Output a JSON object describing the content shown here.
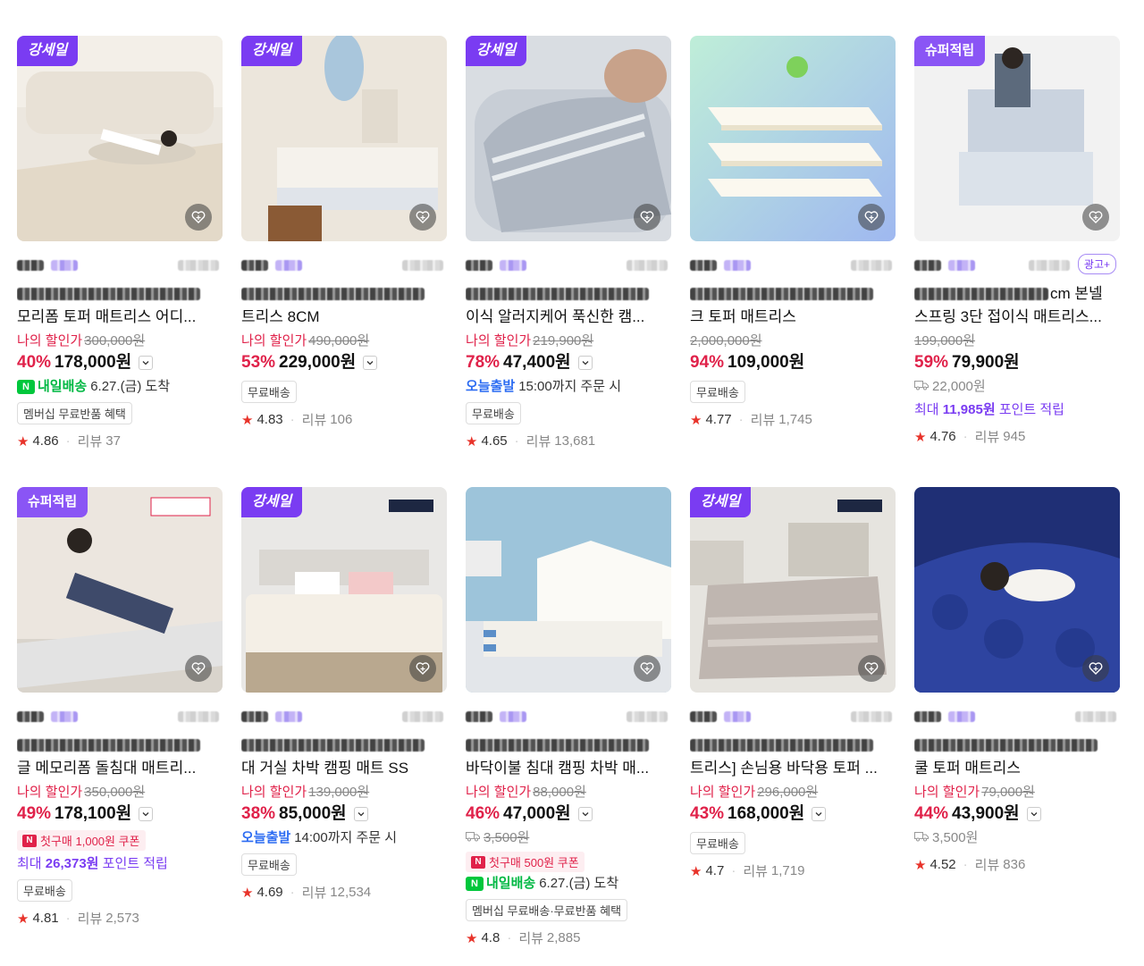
{
  "products": [
    {
      "badge": "강세일",
      "badge_type": "sale",
      "ad_label": "",
      "title_l2": "모리폼 토퍼 매트리스 어디...",
      "title_l1_tail": "",
      "my_price_label": "나의 할인가",
      "original_price": "300,000원",
      "rate": "40%",
      "price": "178,000원",
      "delivery_type": "nday",
      "delivery_text": "내일배송",
      "delivery_detail": "6.27.(금) 도착",
      "ship_fee": "",
      "chips": [
        "멤버십 무료반품 혜택"
      ],
      "coupon": "",
      "points_prefix": "",
      "points_amount": "",
      "points_suffix": "",
      "rating": "4.86",
      "review_label": "리뷰",
      "review_count": "37"
    },
    {
      "badge": "강세일",
      "badge_type": "sale",
      "ad_label": "",
      "title_l2": "트리스 8CM",
      "title_l1_tail": "",
      "my_price_label": "나의 할인가",
      "original_price": "490,000원",
      "rate": "53%",
      "price": "229,000원",
      "delivery_type": "",
      "delivery_text": "",
      "delivery_detail": "",
      "ship_fee": "",
      "chips": [
        "무료배송"
      ],
      "coupon": "",
      "points_prefix": "",
      "points_amount": "",
      "points_suffix": "",
      "rating": "4.83",
      "review_label": "리뷰",
      "review_count": "106"
    },
    {
      "badge": "강세일",
      "badge_type": "sale",
      "ad_label": "",
      "title_l2": "이식 알러지케어 푹신한 캠...",
      "title_l1_tail": "",
      "my_price_label": "나의 할인가",
      "original_price": "219,900원",
      "rate": "78%",
      "price": "47,400원",
      "delivery_type": "today",
      "delivery_text": "오늘출발",
      "delivery_detail": "15:00까지 주문 시",
      "ship_fee": "",
      "chips": [
        "무료배송"
      ],
      "coupon": "",
      "points_prefix": "",
      "points_amount": "",
      "points_suffix": "",
      "rating": "4.65",
      "review_label": "리뷰",
      "review_count": "13,681"
    },
    {
      "badge": "",
      "badge_type": "",
      "ad_label": "",
      "title_l2": "크 토퍼 매트리스",
      "title_l1_tail": "",
      "my_price_label": "",
      "original_price": "2,000,000원",
      "rate": "94%",
      "price": "109,000원",
      "delivery_type": "",
      "delivery_text": "",
      "delivery_detail": "",
      "ship_fee": "",
      "chips": [
        "무료배송"
      ],
      "coupon": "",
      "points_prefix": "",
      "points_amount": "",
      "points_suffix": "",
      "rating": "4.77",
      "review_label": "리뷰",
      "review_count": "1,745"
    },
    {
      "badge": "슈퍼적립",
      "badge_type": "super",
      "ad_label": "광고+",
      "title_l2": "스프링 3단 접이식 매트리스...",
      "title_l1_tail": "cm 본넬",
      "my_price_label": "",
      "original_price": "199,000원",
      "rate": "59%",
      "price": "79,900원",
      "delivery_type": "",
      "delivery_text": "",
      "delivery_detail": "",
      "ship_fee": "22,000원",
      "chips": [],
      "coupon": "",
      "points_prefix": "최대",
      "points_amount": "11,985원",
      "points_suffix": "포인트 적립",
      "rating": "4.76",
      "review_label": "리뷰",
      "review_count": "945"
    },
    {
      "badge": "슈퍼적립",
      "badge_type": "super",
      "ad_label": "",
      "title_l2": "글 메모리폼 돌침대 매트리...",
      "title_l1_tail": "",
      "my_price_label": "나의 할인가",
      "original_price": "350,000원",
      "rate": "49%",
      "price": "178,100원",
      "delivery_type": "",
      "delivery_text": "",
      "delivery_detail": "",
      "ship_fee": "",
      "chips": [
        "무료배송"
      ],
      "coupon": "첫구매 1,000원 쿠폰",
      "points_prefix": "최대",
      "points_amount": "26,373원",
      "points_suffix": "포인트 적립",
      "rating": "4.81",
      "review_label": "리뷰",
      "review_count": "2,573"
    },
    {
      "badge": "강세일",
      "badge_type": "sale",
      "ad_label": "",
      "title_l2": "대 거실 차박 캠핑 매트 SS",
      "title_l1_tail": "",
      "my_price_label": "나의 할인가",
      "original_price": "139,000원",
      "rate": "38%",
      "price": "85,000원",
      "delivery_type": "today",
      "delivery_text": "오늘출발",
      "delivery_detail": "14:00까지 주문 시",
      "ship_fee": "",
      "chips": [
        "무료배송"
      ],
      "coupon": "",
      "points_prefix": "",
      "points_amount": "",
      "points_suffix": "",
      "rating": "4.69",
      "review_label": "리뷰",
      "review_count": "12,534"
    },
    {
      "badge": "",
      "badge_type": "",
      "ad_label": "",
      "title_l2": "바닥이불 침대 캠핑 차박 매...",
      "title_l1_tail": "",
      "my_price_label": "나의 할인가",
      "original_price": "88,000원",
      "rate": "46%",
      "price": "47,000원",
      "delivery_type": "nday",
      "delivery_text": "내일배송",
      "delivery_detail": "6.27.(금) 도착",
      "ship_fee": "3,500원",
      "chips": [
        "멤버십 무료배송·무료반품 혜택"
      ],
      "coupon": "첫구매 500원 쿠폰",
      "points_prefix": "",
      "points_amount": "",
      "points_suffix": "",
      "rating": "4.8",
      "review_label": "리뷰",
      "review_count": "2,885"
    },
    {
      "badge": "강세일",
      "badge_type": "sale",
      "ad_label": "",
      "title_l2": "트리스] 손님용 바닥용 토퍼 ...",
      "title_l1_tail": "",
      "my_price_label": "나의 할인가",
      "original_price": "296,000원",
      "rate": "43%",
      "price": "168,000원",
      "delivery_type": "",
      "delivery_text": "",
      "delivery_detail": "",
      "ship_fee": "",
      "chips": [
        "무료배송"
      ],
      "coupon": "",
      "points_prefix": "",
      "points_amount": "",
      "points_suffix": "",
      "rating": "4.7",
      "review_label": "리뷰",
      "review_count": "1,719"
    },
    {
      "badge": "",
      "badge_type": "",
      "ad_label": "",
      "title_l2": "쿨 토퍼 매트리스",
      "title_l1_tail": "",
      "my_price_label": "나의 할인가",
      "original_price": "79,000원",
      "rate": "44%",
      "price": "43,900원",
      "delivery_type": "",
      "delivery_text": "",
      "delivery_detail": "",
      "ship_fee": "3,500원",
      "chips": [],
      "coupon": "",
      "points_prefix": "",
      "points_amount": "",
      "points_suffix": "",
      "rating": "4.52",
      "review_label": "리뷰",
      "review_count": "836"
    }
  ],
  "colors": {
    "sale_badge": "#7a3cf2",
    "super_badge": "#8a55f5",
    "discount": "#e0224a",
    "nday": "#00b843",
    "today": "#2c6cf2",
    "star": "#e8332a"
  },
  "icons": {
    "wishlist": "heart-plus-icon",
    "star": "star-icon",
    "chevron": "chevron-down-icon",
    "shipping": "truck-icon"
  }
}
